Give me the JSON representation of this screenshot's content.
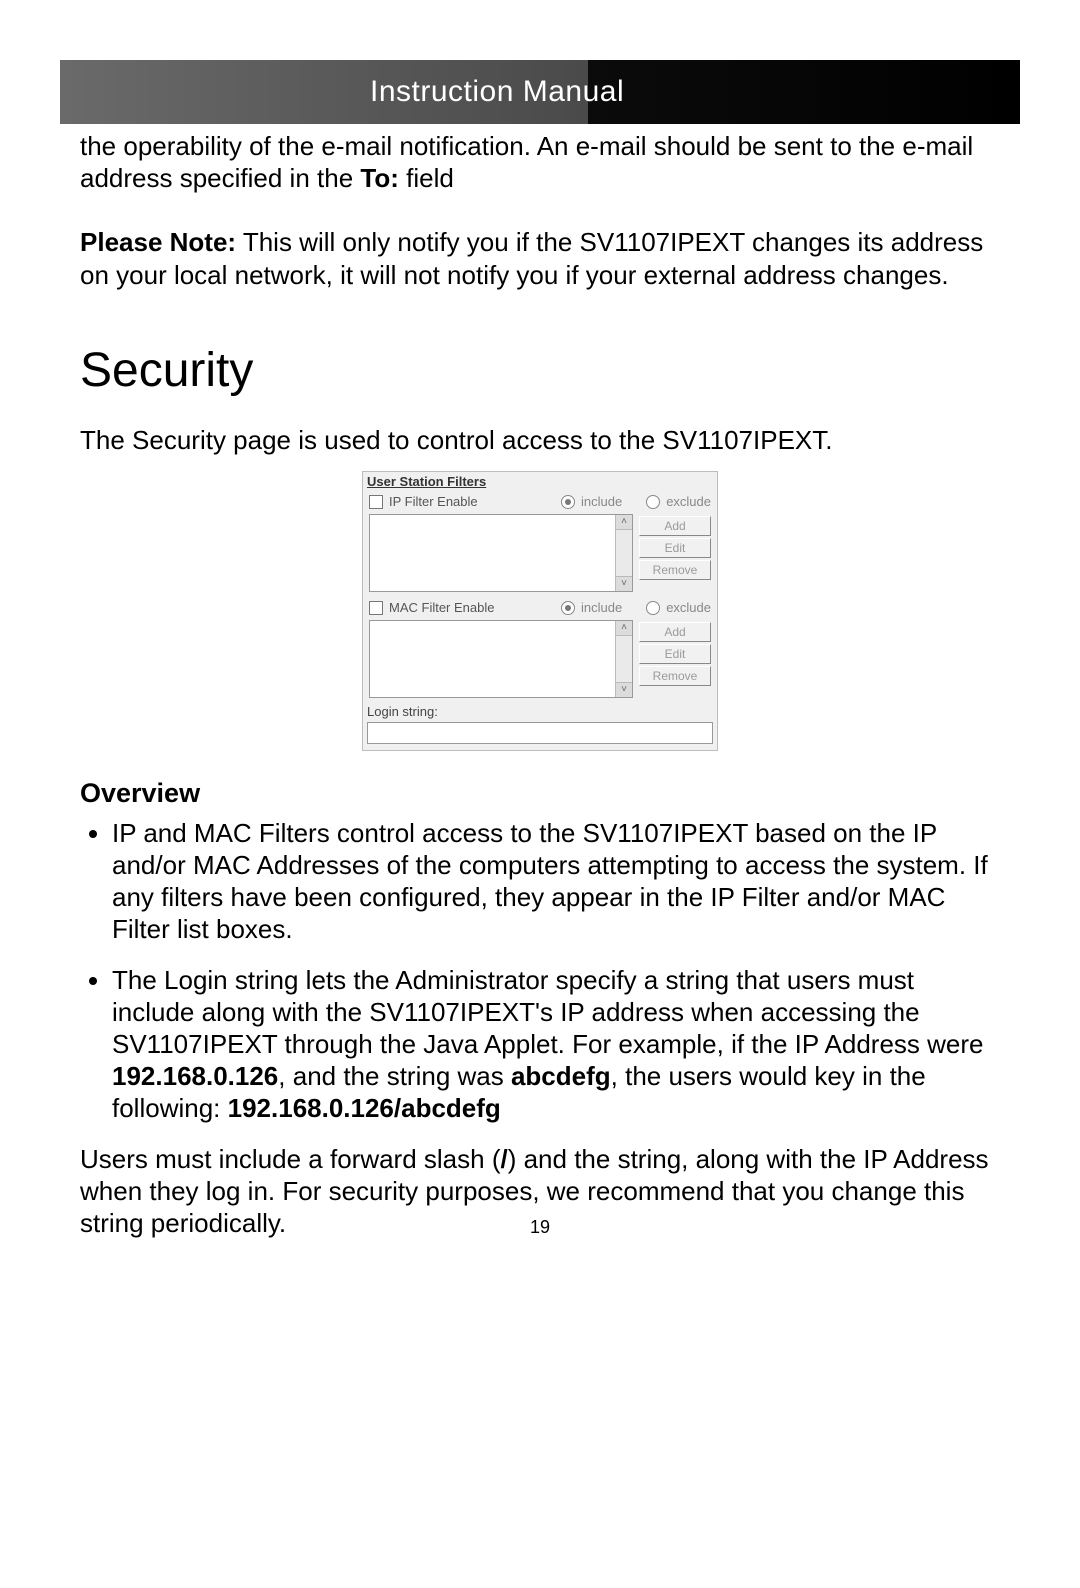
{
  "header": {
    "title": "Instruction Manual"
  },
  "intro": {
    "line1": "the operability of the e-mail notification. An e-mail should be sent to the e-mail address specified in the ",
    "to_label": "To:",
    "line1_tail": " field",
    "note_label": "Please Note:",
    "note_body": " This will only notify you if the SV1107IPEXT changes its address on your local network, it will not notify you if your external address changes."
  },
  "security": {
    "heading": "Security",
    "intro": "The Security page is used to control access to the SV1107IPEXT."
  },
  "usf": {
    "title": "User Station Filters",
    "ip": {
      "enable_label": "IP Filter Enable",
      "include": "include",
      "exclude": "exclude",
      "add": "Add",
      "edit": "Edit",
      "remove": "Remove"
    },
    "mac": {
      "enable_label": "MAC Filter Enable",
      "include": "include",
      "exclude": "exclude",
      "add": "Add",
      "edit": "Edit",
      "remove": "Remove"
    },
    "login_label": "Login string:"
  },
  "overview": {
    "heading": "Overview",
    "bullet1": "IP and MAC Filters control access to the SV1107IPEXT based on the IP and/or MAC Addresses of the computers attempting to access the system. If any filters have been configured, they appear in the IP Filter and/or MAC Filter list boxes.",
    "bullet2_a": "The Login string lets the Administrator specify a string that users must include along with the SV1107IPEXT's IP address when accessing the SV1107IPEXT through the Java Applet.  For example, if the IP Address were ",
    "ip_example": "192.168.0.126",
    "bullet2_b": ", and the string was ",
    "str_example": "abcdefg",
    "bullet2_c": ", the users would key in the following: ",
    "full_example": "192.168.0.126/abcdefg",
    "trailing_a": "Users must include a forward slash (",
    "slash": "/",
    "trailing_b": ") and the string, along with the IP Address when they log in.  For security purposes, we recommend that you change this string periodically."
  },
  "page_number": "19"
}
